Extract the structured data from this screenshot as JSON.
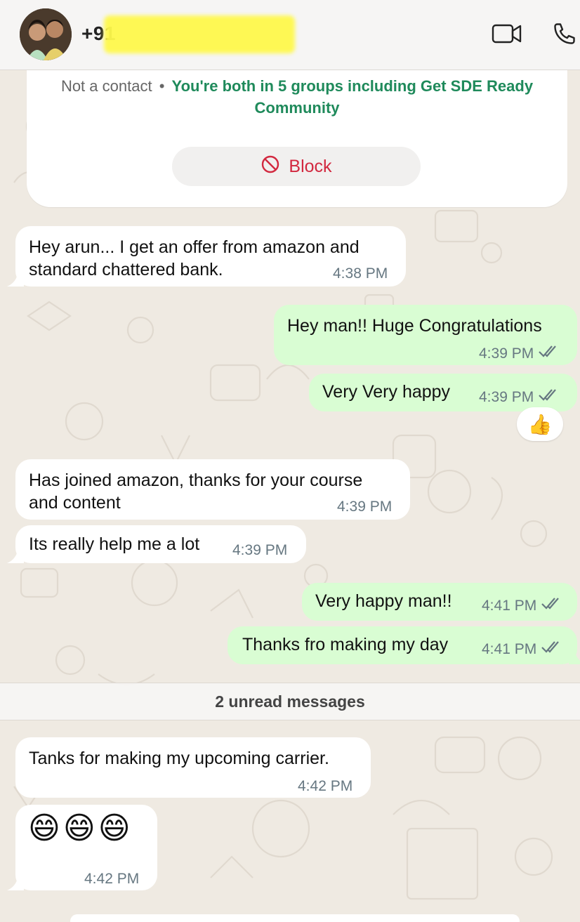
{
  "header": {
    "contact_name": "+91"
  },
  "system_card": {
    "not_contact": "Not a contact",
    "separator": "•",
    "groups_info": "You're both in 5 groups including Get SDE Ready Community",
    "block_label": "Block"
  },
  "messages": [
    {
      "direction": "in",
      "lines": [
        "Hey arun... I get an offer from amazon and",
        "standard chattered bank."
      ],
      "time": "4:38 PM"
    },
    {
      "direction": "out",
      "lines": [
        "Hey man!! Huge Congratulations"
      ],
      "time": "4:39 PM"
    },
    {
      "direction": "out",
      "lines": [
        "Very Very happy"
      ],
      "time": "4:39 PM",
      "reaction": "👍"
    },
    {
      "direction": "in",
      "lines": [
        "Has joined amazon, thanks for your course",
        "and content"
      ],
      "time": "4:39 PM"
    },
    {
      "direction": "in",
      "lines": [
        "Its really help me a lot"
      ],
      "time": "4:39 PM"
    },
    {
      "direction": "out",
      "lines": [
        "Very happy man!!"
      ],
      "time": "4:41 PM"
    },
    {
      "direction": "out",
      "lines": [
        "Thanks fro making my day"
      ],
      "time": "4:41 PM"
    },
    {
      "direction": "in",
      "lines": [
        "Tanks for making my upcoming carrier."
      ],
      "time": "4:42 PM"
    },
    {
      "direction": "in",
      "lines": [
        "😄😄😄"
      ],
      "time": "4:42 PM"
    }
  ],
  "unread_divider": "2 unread messages",
  "colors": {
    "incoming_bubble": "#ffffff",
    "outgoing_bubble": "#d9fdd3",
    "accent_green": "#1f8a5b",
    "block_red": "#d2283f",
    "chat_background": "#efeae2"
  },
  "icons": {
    "video_call": "video-camera-icon",
    "voice_call": "phone-icon",
    "block": "block-circle-icon",
    "read_receipt": "double-check-icon"
  }
}
